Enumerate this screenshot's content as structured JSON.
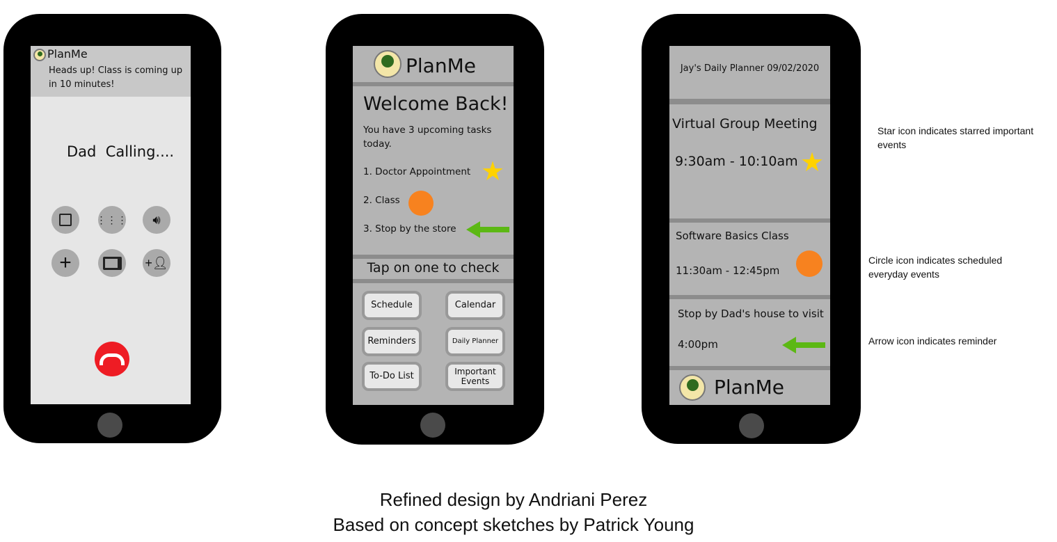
{
  "phone1": {
    "app_name": "PlanMe",
    "notification": "Heads up! Class is coming up in 10 minutes!",
    "caller": "Dad  Calling....",
    "buttons": [
      "mute-icon",
      "keypad-icon",
      "speaker-icon",
      "add-call-icon",
      "video-icon",
      "add-contact-icon"
    ],
    "end_call_color": "#ee1c24"
  },
  "phone2": {
    "app_name": "PlanMe",
    "welcome": "Welcome Back!",
    "subtitle": "You have 3 upcoming tasks today.",
    "tasks": [
      "1. Doctor Appointment",
      "2. Class",
      "3. Stop by the store"
    ],
    "prompt": "Tap on one to check",
    "buttons": [
      "Schedule",
      "Calendar",
      "Reminders",
      "Daily Planner",
      "To-Do List",
      "Important Events"
    ]
  },
  "phone3": {
    "title": "Jay's Daily Planner 09/02/2020",
    "events": [
      {
        "name": "Virtual Group Meeting",
        "time": "9:30am - 10:10am"
      },
      {
        "name": "Software Basics Class",
        "time": "11:30am - 12:45pm"
      },
      {
        "name": "Stop by Dad's house to visit",
        "time": "4:00pm"
      }
    ],
    "app_name": "PlanMe"
  },
  "annotations": [
    "Star icon indicates starred important events",
    "Circle icon indicates scheduled everyday events",
    "Arrow icon indicates reminder"
  ],
  "captions": [
    "Refined design by Andriani Perez",
    "Based on concept sketches by Patrick Young"
  ],
  "colors": {
    "star": "#ffd200",
    "circle": "#f7821f",
    "arrow": "#5cb814"
  }
}
